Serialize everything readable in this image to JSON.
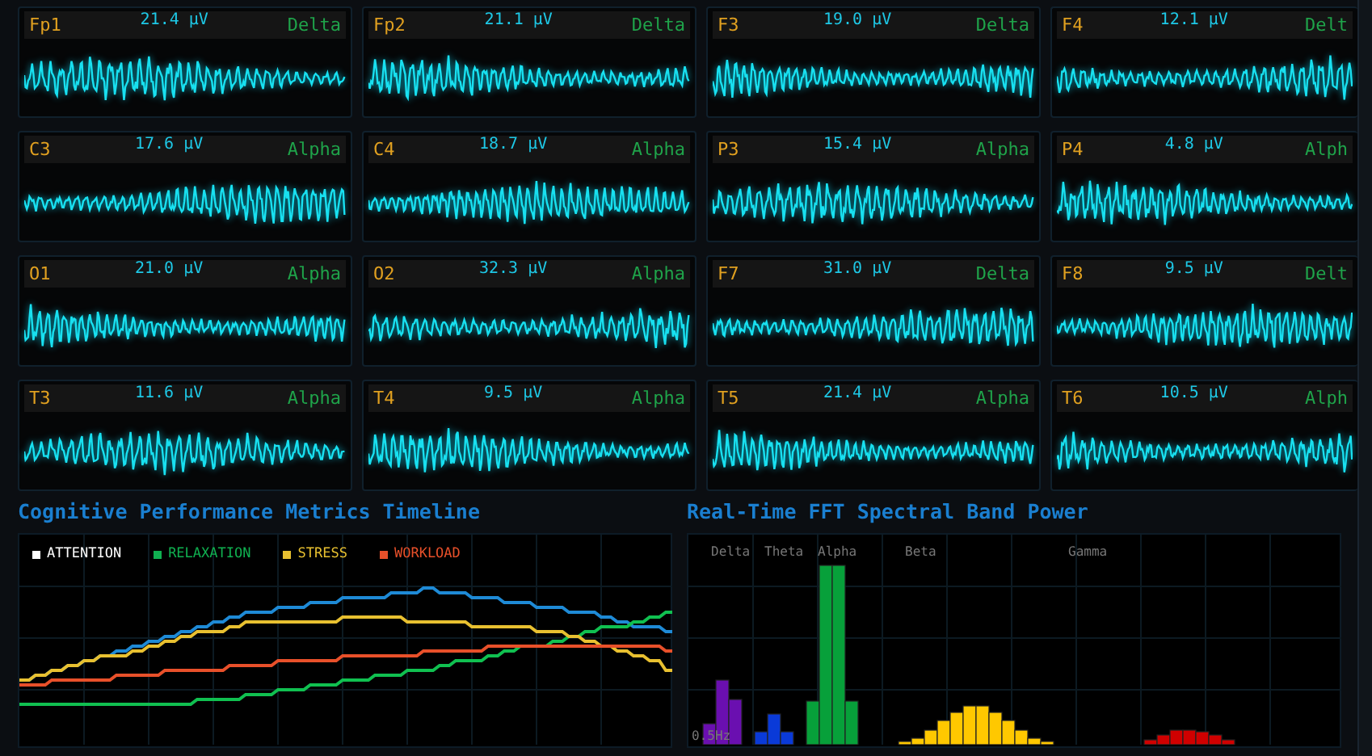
{
  "channels": [
    {
      "name": "Fp1",
      "amplitude": "21.4 µV",
      "band": "Delta"
    },
    {
      "name": "Fp2",
      "amplitude": "21.1 µV",
      "band": "Delta"
    },
    {
      "name": "F3",
      "amplitude": "19.0 µV",
      "band": "Delta"
    },
    {
      "name": "F4",
      "amplitude": "12.1 µV",
      "band": "Delt"
    },
    {
      "name": "C3",
      "amplitude": "17.6 µV",
      "band": "Alpha"
    },
    {
      "name": "C4",
      "amplitude": "18.7 µV",
      "band": "Alpha"
    },
    {
      "name": "P3",
      "amplitude": "15.4 µV",
      "band": "Alpha"
    },
    {
      "name": "P4",
      "amplitude": "4.8 µV",
      "band": "Alph"
    },
    {
      "name": "O1",
      "amplitude": "21.0 µV",
      "band": "Alpha"
    },
    {
      "name": "O2",
      "amplitude": "32.3 µV",
      "band": "Alpha"
    },
    {
      "name": "F7",
      "amplitude": "31.0 µV",
      "band": "Delta"
    },
    {
      "name": "F8",
      "amplitude": "9.5 µV",
      "band": "Delt"
    },
    {
      "name": "T3",
      "amplitude": "11.6 µV",
      "band": "Alpha"
    },
    {
      "name": "T4",
      "amplitude": "9.5 µV",
      "band": "Alpha"
    },
    {
      "name": "T5",
      "amplitude": "21.4 µV",
      "band": "Alpha"
    },
    {
      "name": "T6",
      "amplitude": "10.5 µV",
      "band": "Alph"
    }
  ],
  "timeline": {
    "title": "Cognitive Performance Metrics Timeline",
    "legend": [
      {
        "label": "ATTENTION",
        "color": "#ffffff"
      },
      {
        "label": "RELAXATION",
        "color": "#10b050"
      },
      {
        "label": "STRESS",
        "color": "#e8c030"
      },
      {
        "label": "WORKLOAD",
        "color": "#e8502a"
      }
    ]
  },
  "spectrum": {
    "title": "Real-Time FFT Spectral Band Power",
    "axis_label": "0.5Hz",
    "bands": [
      {
        "label": "Delta",
        "color": "#6a0fb0"
      },
      {
        "label": "Theta",
        "color": "#0a3ad8"
      },
      {
        "label": "Alpha",
        "color": "#07a03a"
      },
      {
        "label": "Beta",
        "color": "#ffc800"
      },
      {
        "label": "Gamma",
        "color": "#d00000"
      }
    ]
  }
}
